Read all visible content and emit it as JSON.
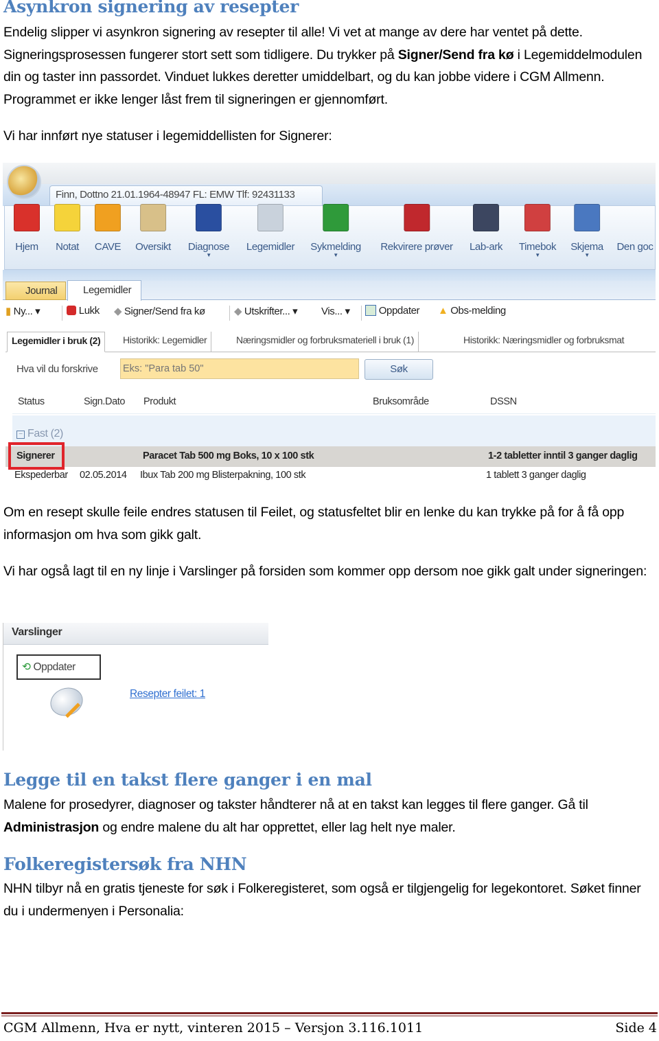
{
  "section1": {
    "heading": "Asynkron signering av resepter",
    "para1_a": "Endelig slipper vi asynkron signering av resepter til alle! Vi vet at mange av dere har ventet på dette. Signeringsprosessen fungerer stort sett som tidligere. Du trykker på ",
    "para1_bold": "Signer/Send fra kø",
    "para1_b": " i Legemiddelmodulen din og taster inn passordet. Vinduet lukkes deretter umiddelbart, og du kan jobbe videre i CGM Allmenn. Programmet er ikke lenger låst frem til signeringen er gjennomført.",
    "para2": "Vi har innført nye statuser i legemiddellisten for Signerer:",
    "para3": "Om en resept skulle feile endres statusen til Feilet, og statusfeltet blir en lenke du kan trykke på for å få opp informasjon om hva som gikk galt.",
    "para4": "Vi har også lagt til en ny linje i Varslinger på forsiden som kommer opp dersom noe gikk galt under signeringen:"
  },
  "screenshot1": {
    "patient_tab": "Finn, Dottno 21.01.1964-48947 FL: EMW Tlf: 92431133",
    "ribbon": [
      {
        "label": "Hjem",
        "icon": "home-icon",
        "color": "#d9312b",
        "dropdown": false
      },
      {
        "label": "Notat",
        "icon": "note-icon",
        "color": "#f5d33a",
        "dropdown": false
      },
      {
        "label": "CAVE",
        "icon": "warning-icon",
        "color": "#f0a020",
        "dropdown": false
      },
      {
        "label": "Oversikt",
        "icon": "folder-icon",
        "color": "#d8c089",
        "dropdown": false
      },
      {
        "label": "Diagnose",
        "icon": "stethoscope-icon",
        "color": "#2a4fa0",
        "dropdown": true
      },
      {
        "label": "Legemidler",
        "icon": "pill-icon",
        "color": "#c9d2dc",
        "dropdown": false
      },
      {
        "label": "Sykmelding",
        "icon": "wheelchair-icon",
        "color": "#2f9a3a",
        "dropdown": true
      },
      {
        "label": "Rekvirere prøver",
        "icon": "test-tube-icon",
        "color": "#c0282d",
        "dropdown": false
      },
      {
        "label": "Lab-ark",
        "icon": "lab-sheet-icon",
        "color": "#3c4660",
        "dropdown": false
      },
      {
        "label": "Timebok",
        "icon": "calendar-icon",
        "color": "#d04040",
        "dropdown": true
      },
      {
        "label": "Skjema",
        "icon": "form-icon",
        "color": "#4a78c0",
        "dropdown": true
      },
      {
        "label": "Den goc",
        "icon": "",
        "color": "#ffffff",
        "dropdown": false
      }
    ],
    "module_tabs": [
      "Journal",
      "Legemidler"
    ],
    "toolbar": {
      "new": "Ny...",
      "close": "Lukk",
      "sign": "Signer/Send fra kø",
      "print": "Utskrifter...",
      "view": "Vis...",
      "refresh": "Oppdater",
      "obs": "Obs-melding"
    },
    "sub_tabs": [
      "Legemidler i bruk (2)",
      "Historikk: Legemidler",
      "Næringsmidler og forbruksmateriell i bruk (1)",
      "Historikk: Næringsmidler og forbruksmat"
    ],
    "search": {
      "label": "Hva vil du forskrive",
      "placeholder": "Eks: \"Para tab 50\"",
      "button": "Søk"
    },
    "columns": [
      "Status",
      "Sign.Dato",
      "Produkt",
      "Bruksområde",
      "DSSN"
    ],
    "group": "Fast (2)",
    "rows": [
      {
        "status": "Signerer",
        "date": "",
        "product": "Paracet Tab 500 mg Boks, 10 x 100 stk",
        "dssn": "1-2 tabletter inntil 3 ganger daglig"
      },
      {
        "status": "Ekspederbar",
        "date": "02.05.2014",
        "product": "Ibux Tab 200 mg Blisterpakning, 100 stk",
        "dssn": "1 tablett 3 ganger daglig"
      }
    ],
    "highlight_color": "#e0242b"
  },
  "screenshot2": {
    "title": "Varslinger",
    "refresh": "Oppdater",
    "link": "Resepter feilet: 1"
  },
  "section2": {
    "heading": "Legge til en takst flere ganger i en mal",
    "para_a": "Malene for prosedyrer, diagnoser og takster håndterer nå at en takst kan legges til flere ganger. Gå til ",
    "para_bold": "Administrasjon",
    "para_b": " og endre malene du alt har opprettet, eller lag helt nye maler."
  },
  "section3": {
    "heading": "Folkeregistersøk fra NHN",
    "para": "NHN tilbyr nå en gratis tjeneste for søk i Folkeregisteret, som også er tilgjengelig for legekontoret. Søket finner du i undermenyen i Personalia:"
  },
  "footer": {
    "left": "CGM Allmenn, Hva er nytt, vinteren 2015 – Versjon 3.116.1011",
    "right": "Side 4"
  },
  "colors": {
    "heading": "#4f81bd",
    "footer_rule": "#7a1f1f",
    "link": "#2f6fd0"
  }
}
